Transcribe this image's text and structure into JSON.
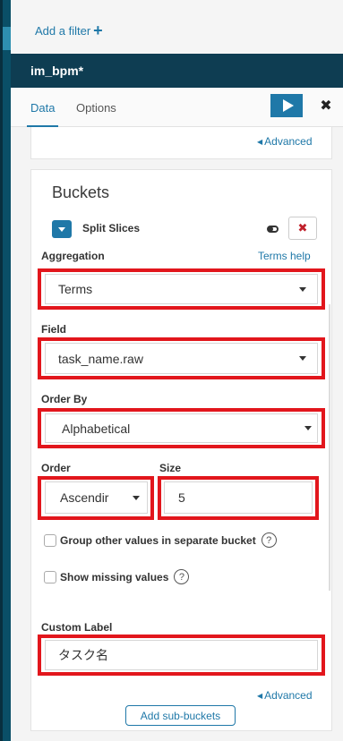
{
  "filter": {
    "add_label": "Add a filter"
  },
  "index": {
    "name": "im_bpm*"
  },
  "tabs": [
    {
      "label": "Data",
      "active": true
    },
    {
      "label": "Options",
      "active": false
    }
  ],
  "top_card": {
    "advanced_label": "Advanced"
  },
  "buckets": {
    "title": "Buckets",
    "split_label": "Split Slices",
    "aggregation": {
      "label": "Aggregation",
      "help_link": "Terms help",
      "value": "Terms"
    },
    "field": {
      "label": "Field",
      "value": "task_name.raw"
    },
    "order_by": {
      "label": "Order By",
      "value": "Alphabetical"
    },
    "order": {
      "label": "Order",
      "value": "Ascendir"
    },
    "size": {
      "label": "Size",
      "value": "5"
    },
    "group_other": {
      "label": "Group other values in separate bucket",
      "checked": false
    },
    "show_missing": {
      "label": "Show missing values",
      "checked": false
    },
    "custom_label": {
      "label": "Custom Label",
      "value": "タスク名"
    },
    "advanced_label": "Advanced",
    "add_sub_buckets_label": "Add sub-buckets",
    "help_glyph": "?"
  },
  "colors": {
    "accent": "#1f78a8",
    "header": "#0e3d52",
    "highlight": "#e2161c",
    "remove": "#c0202b"
  },
  "icons": {
    "add": "plus-icon",
    "run": "play-icon",
    "close": "close-icon",
    "toggle": "toggle-icon",
    "remove": "remove-icon",
    "help": "help-circle-icon"
  }
}
